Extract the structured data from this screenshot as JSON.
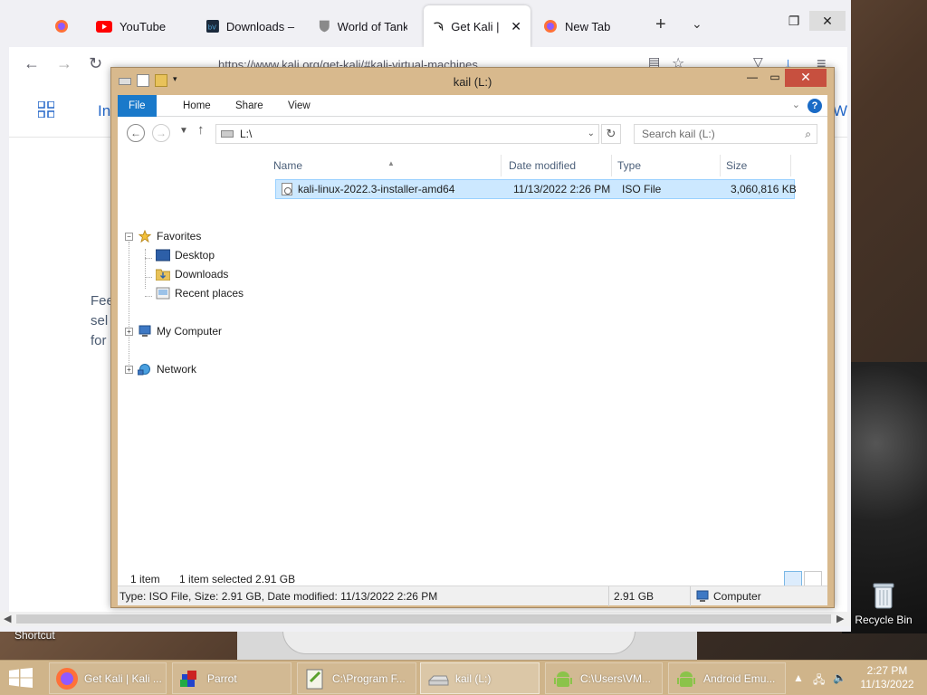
{
  "browser": {
    "tabs": [
      {
        "label": "",
        "icon": "firefox-icon"
      },
      {
        "label": "YouTube",
        "icon": "youtube-icon"
      },
      {
        "label": "Downloads – B",
        "icon": "blackview-icon"
      },
      {
        "label": "World of Tanks",
        "icon": "wot-shield-icon"
      },
      {
        "label": "Get Kali | Kal",
        "icon": "kali-dragon-icon",
        "active": true
      },
      {
        "label": "New Tab",
        "icon": "firefox-icon"
      }
    ],
    "url": "https://www.kali.org/get-kali/#kali-virtual-machines",
    "page_partial": {
      "nav_letter": "In",
      "nav_letter_right": "W",
      "para_lines": [
        "Fee",
        "sel",
        "for"
      ]
    }
  },
  "explorer": {
    "title": "kail (L:)",
    "ribbon_tabs": [
      "File",
      "Home",
      "Share",
      "View"
    ],
    "address": "L:\\",
    "search_placeholder": "Search kail (L:)",
    "nav": {
      "favorites": "Favorites",
      "desktop": "Desktop",
      "downloads": "Downloads",
      "recent": "Recent places",
      "computer": "My Computer",
      "network": "Network"
    },
    "columns": {
      "name": "Name",
      "date": "Date modified",
      "type": "Type",
      "size": "Size"
    },
    "files": [
      {
        "name": "kali-linux-2022.3-installer-amd64",
        "date": "11/13/2022 2:26 PM",
        "type": "ISO File",
        "size": "3,060,816 KB"
      }
    ],
    "status": {
      "count": "1 item",
      "selected": "1 item selected  2.91 GB"
    },
    "details": {
      "info": "Type: ISO File, Size: 2.91 GB, Date modified: 11/13/2022 2:26 PM",
      "size": "2.91 GB",
      "location": "Computer"
    }
  },
  "desktop": {
    "recycle_bin": "Recycle Bin",
    "shortcut_label": "Shortcut"
  },
  "taskbar": {
    "items": [
      {
        "label": "Get Kali | Kali ...",
        "icon": "firefox-icon"
      },
      {
        "label": "Parrot",
        "icon": "parrot-icon"
      },
      {
        "label": "C:\\Program F...",
        "icon": "notepadpp-icon"
      },
      {
        "label": "kail (L:)",
        "icon": "drive-icon",
        "active": true
      },
      {
        "label": "C:\\Users\\VM...",
        "icon": "android-icon"
      },
      {
        "label": "Android Emu...",
        "icon": "android-icon"
      }
    ],
    "time": "2:27 PM",
    "date": "11/13/2022"
  },
  "colors": {
    "accent": "#1979ca",
    "selection": "#cce8ff",
    "frame": "#d8b98d",
    "close": "#c7503f"
  }
}
